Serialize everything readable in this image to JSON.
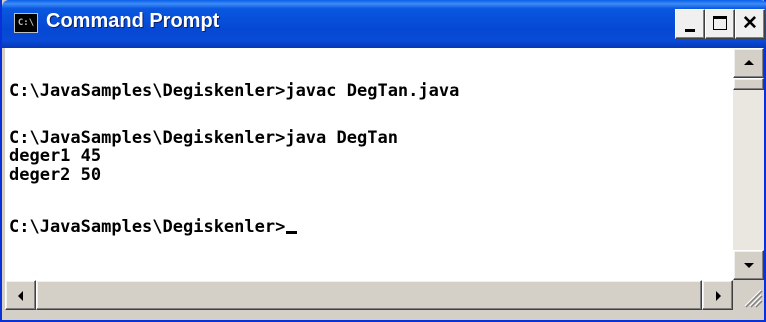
{
  "window": {
    "title": "Command Prompt",
    "app_icon_text": "C:\\",
    "close_glyph": "✕"
  },
  "console": {
    "lines": [
      "",
      "C:\\JavaSamples\\Degiskenler>javac DegTan.java",
      "",
      "C:\\JavaSamples\\Degiskenler>java DegTan",
      "deger1 45",
      "deger2 50",
      "",
      "C:\\JavaSamples\\Degiskenler>"
    ]
  },
  "colors": {
    "titlebar": "#0548d4",
    "console_bg": "#ffffff",
    "console_text": "#000000"
  }
}
